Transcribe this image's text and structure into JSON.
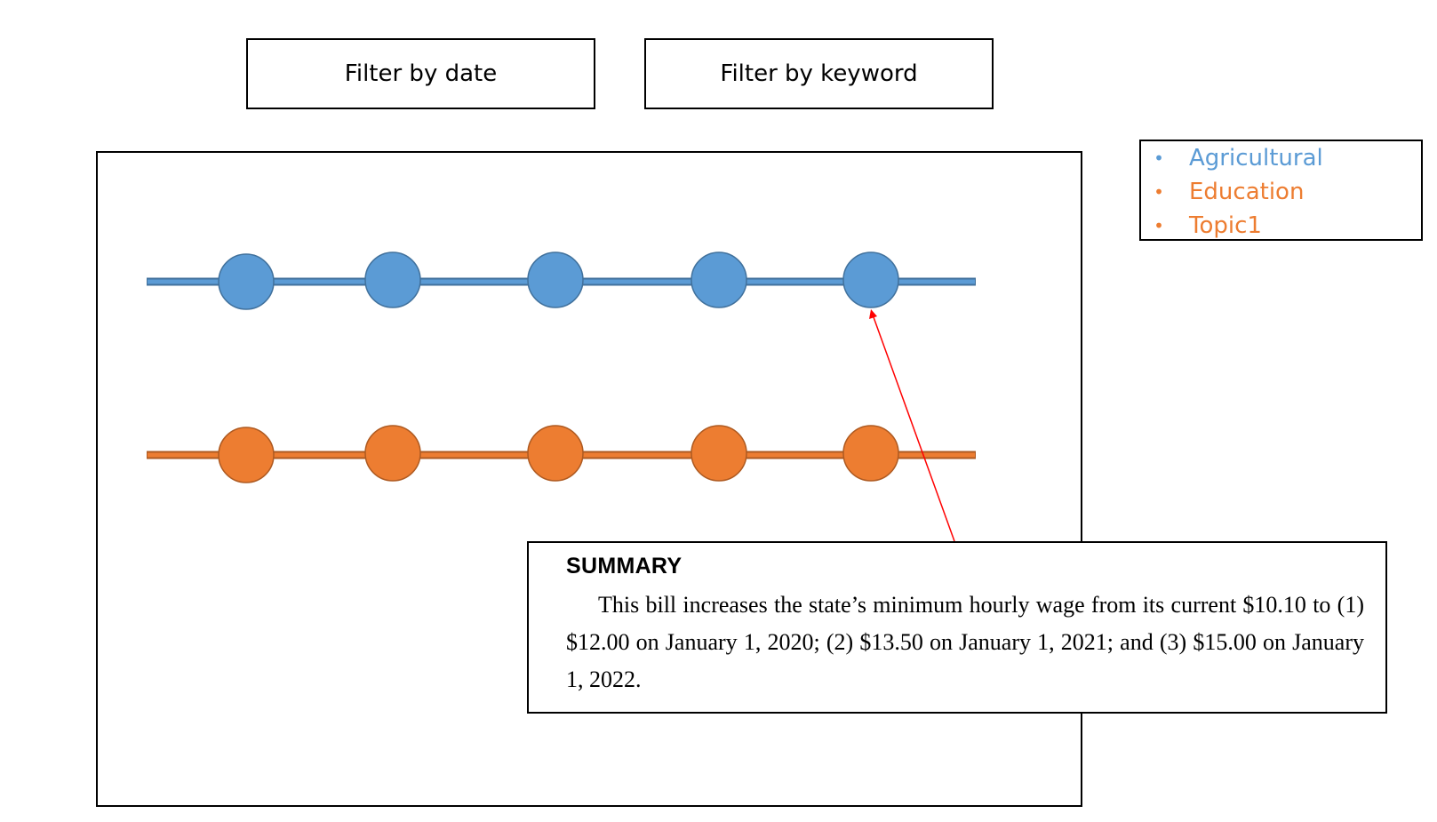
{
  "filters": {
    "date_label": "Filter by date",
    "keyword_label": "Filter by keyword"
  },
  "legend": {
    "items": [
      {
        "label": "Agricultural",
        "color": "#5B9BD5"
      },
      {
        "label": "Education",
        "color": "#ED7D31"
      },
      {
        "label": "Topic1",
        "color": "#ED7D31"
      }
    ]
  },
  "timeline": {
    "rows": [
      {
        "topic": "Agricultural",
        "color": "#5B9BD5",
        "stroke": "#41719C",
        "events": 5
      },
      {
        "topic": "Education",
        "color": "#ED7D31",
        "stroke": "#AE5A21",
        "events": 5
      }
    ],
    "pointer_color": "#FF0000"
  },
  "summary": {
    "heading": "SUMMARY",
    "text": "This bill increases the state’s minimum hourly wage from its current $10.10 to (1) $12.00 on January 1, 2020; (2) $13.50 on January 1, 2021; and (3) $15.00 on January 1, 2022."
  }
}
